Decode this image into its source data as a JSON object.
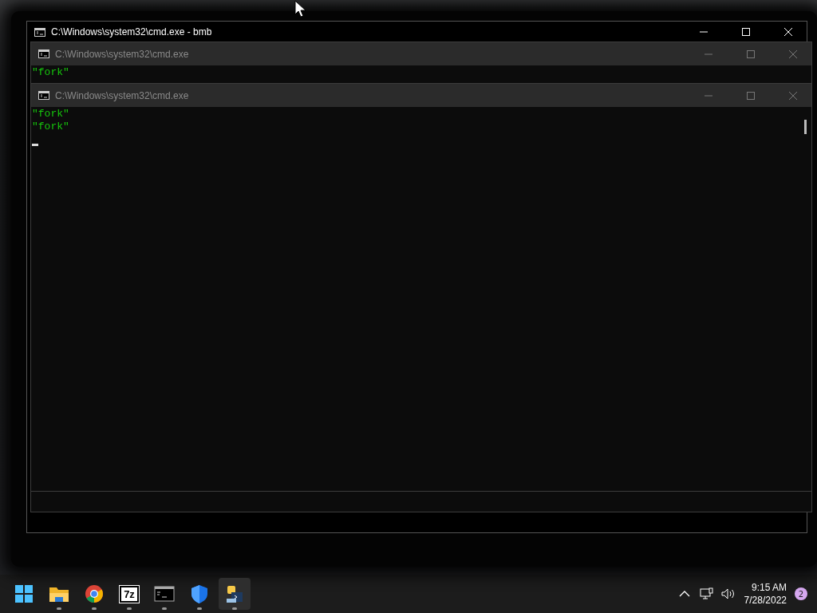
{
  "windows": [
    {
      "title": "C:\\Windows\\system32\\cmd.exe - bmb",
      "active": true
    },
    {
      "title": "C:\\Windows\\system32\\cmd.exe",
      "active": false,
      "lines": [
        "\"fork\""
      ]
    },
    {
      "title": "C:\\Windows\\system32\\cmd.exe",
      "active": false,
      "lines": [
        "\"fork\"",
        "\"fork\""
      ],
      "cursor": true
    }
  ],
  "taskbar": {
    "apps": [
      {
        "kind": "start",
        "running": false,
        "selected": false
      },
      {
        "kind": "folder",
        "running": true,
        "selected": false
      },
      {
        "kind": "browser",
        "running": true,
        "selected": false
      },
      {
        "kind": "archive",
        "label": "7z",
        "running": true,
        "selected": false
      },
      {
        "kind": "console",
        "running": true,
        "selected": false
      },
      {
        "kind": "shield",
        "running": true,
        "selected": false
      },
      {
        "kind": "python",
        "running": true,
        "selected": true
      }
    ],
    "time": "9:15 AM",
    "date": "7/28/2022",
    "notifications": "2"
  }
}
